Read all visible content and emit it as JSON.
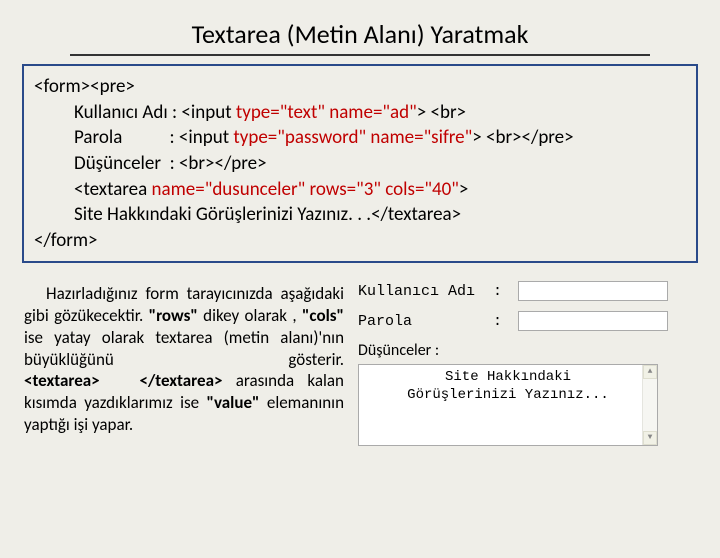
{
  "title": "Textarea (Metin Alanı) Yaratmak",
  "code": {
    "l0": "<form><pre>",
    "l1a": "Kullanıcı Adı : <input ",
    "l1b": "type=\"text\" name=\"ad\"",
    "l1c": "> <br>",
    "l2a": "Parola           : <input ",
    "l2b": "type=\"password\" name=\"sifre\"",
    "l2c": "> <br></pre>",
    "l3": "Düşünceler  : <br></pre>",
    "l4a": "<textarea ",
    "l4b": "name=\"dusunceler\" rows=\"3\" cols=\"40\"",
    "l4c": ">",
    "l5": "Site Hakkındaki Görüşlerinizi Yazınız. . .</textarea>",
    "l6": "</form>"
  },
  "paragraph": {
    "p1a": "Hazırladığınız form tarayıcınızda aşağıdaki gibi gözükecektir. ",
    "rows_b": "\"rows\"",
    "p1b": " dikey olarak , ",
    "cols_b": "\"cols\"",
    "p1c": " ise yatay olarak textarea (metin alanı)'nın büyüklüğünü gösterir. ",
    "ta_open": "<textarea>",
    "ta_close": "</textarea>",
    "p1d": " arasında kalan kısımda yazdıklarımız ise ",
    "value_b": "\"value\"",
    "p1e": " elemanının yaptığı işi yapar."
  },
  "preview": {
    "user_label": "Kullanıcı Adı  :",
    "pass_label": "Parola         :",
    "thoughts_label": "Düşünceler :",
    "ta_l1": "Site Hakkındaki",
    "ta_l2": "Görüşlerinizi Yazınız..."
  }
}
